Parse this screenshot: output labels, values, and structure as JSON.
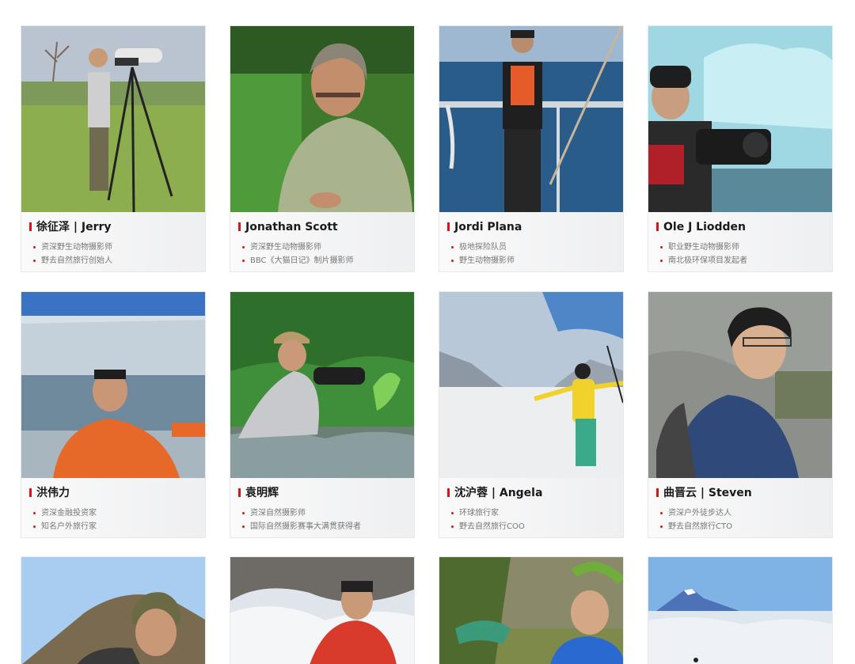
{
  "cards": [
    {
      "name": "徐征泽 | Jerry",
      "lines": [
        "资深野生动物摄影师",
        "野去自然旅行创始人"
      ]
    },
    {
      "name": "Jonathan Scott",
      "lines": [
        "资深野生动物摄影师",
        "BBC《大猫日记》制片摄影师"
      ]
    },
    {
      "name": "Jordi Plana",
      "lines": [
        "极地探险队员",
        "野生动物摄影师"
      ]
    },
    {
      "name": "Ole J Liodden",
      "lines": [
        "职业野生动物摄影师",
        "南北极环保项目发起者"
      ]
    },
    {
      "name": "洪伟力",
      "lines": [
        "资深金融投资家",
        "知名户外旅行家"
      ]
    },
    {
      "name": "袁明辉",
      "lines": [
        "资深自然摄影师",
        "国际自然摄影赛事大满贯获得者"
      ]
    },
    {
      "name": "沈沪蓉 | Angela",
      "lines": [
        "环球旅行家",
        "野去自然旅行COO"
      ]
    },
    {
      "name": "曲晋云 | Steven",
      "lines": [
        "资深户外徒步达人",
        "野去自然旅行CTO"
      ]
    }
  ],
  "colors": {
    "accent": "#d2161c",
    "card_bg": "#eeeff1",
    "text": "#1a1a1a",
    "muted": "#777777"
  }
}
